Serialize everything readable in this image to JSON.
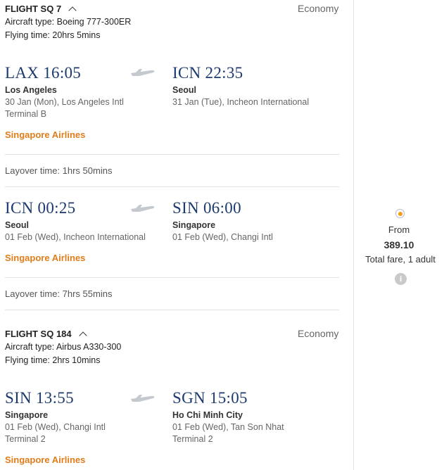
{
  "segments": [
    {
      "flight": "FLIGHT SQ 7",
      "cabin": "Economy",
      "aircraft": "Aircraft type: Boeing 777-300ER",
      "flying_time": "Flying time: 20hrs 5mins",
      "legs": [
        {
          "dep_time": "LAX 16:05",
          "dep_city": "Los Angeles",
          "dep_detail": "30 Jan (Mon), Los Angeles Intl",
          "dep_terminal": "Terminal B",
          "arr_time": "ICN 22:35",
          "arr_city": "Seoul",
          "arr_detail": "31 Jan (Tue), Incheon International",
          "airline": "Singapore Airlines"
        },
        {
          "dep_time": "ICN 00:25",
          "dep_city": "Seoul",
          "dep_detail": "01 Feb (Wed), Incheon International",
          "arr_time": "SIN 06:00",
          "arr_city": "Singapore",
          "arr_detail": "01 Feb (Wed), Changi Intl",
          "airline": "Singapore Airlines"
        }
      ],
      "layovers": [
        "Layover time: 1hrs 50mins",
        "Layover time: 7hrs 55mins"
      ]
    },
    {
      "flight": "FLIGHT SQ 184",
      "cabin": "Economy",
      "aircraft": "Aircraft type: Airbus A330-300",
      "flying_time": "Flying time: 2hrs 10mins",
      "legs": [
        {
          "dep_time": "SIN 13:55",
          "dep_city": "Singapore",
          "dep_detail": "01 Feb (Wed), Changi Intl",
          "dep_terminal": "Terminal 2",
          "arr_time": "SGN 15:05",
          "arr_city": "Ho Chi Minh City",
          "arr_detail": "01 Feb (Wed), Tan Son Nhat",
          "arr_terminal": "Terminal 2",
          "airline": "Singapore Airlines"
        }
      ]
    }
  ],
  "fare": {
    "from_label": "From",
    "amount": "389.10",
    "note": "Total fare, 1 adult",
    "info_icon": "i"
  },
  "colors": {
    "accent": "#e07d1a",
    "time": "#1c3a6e",
    "radio": "#f39c12"
  }
}
